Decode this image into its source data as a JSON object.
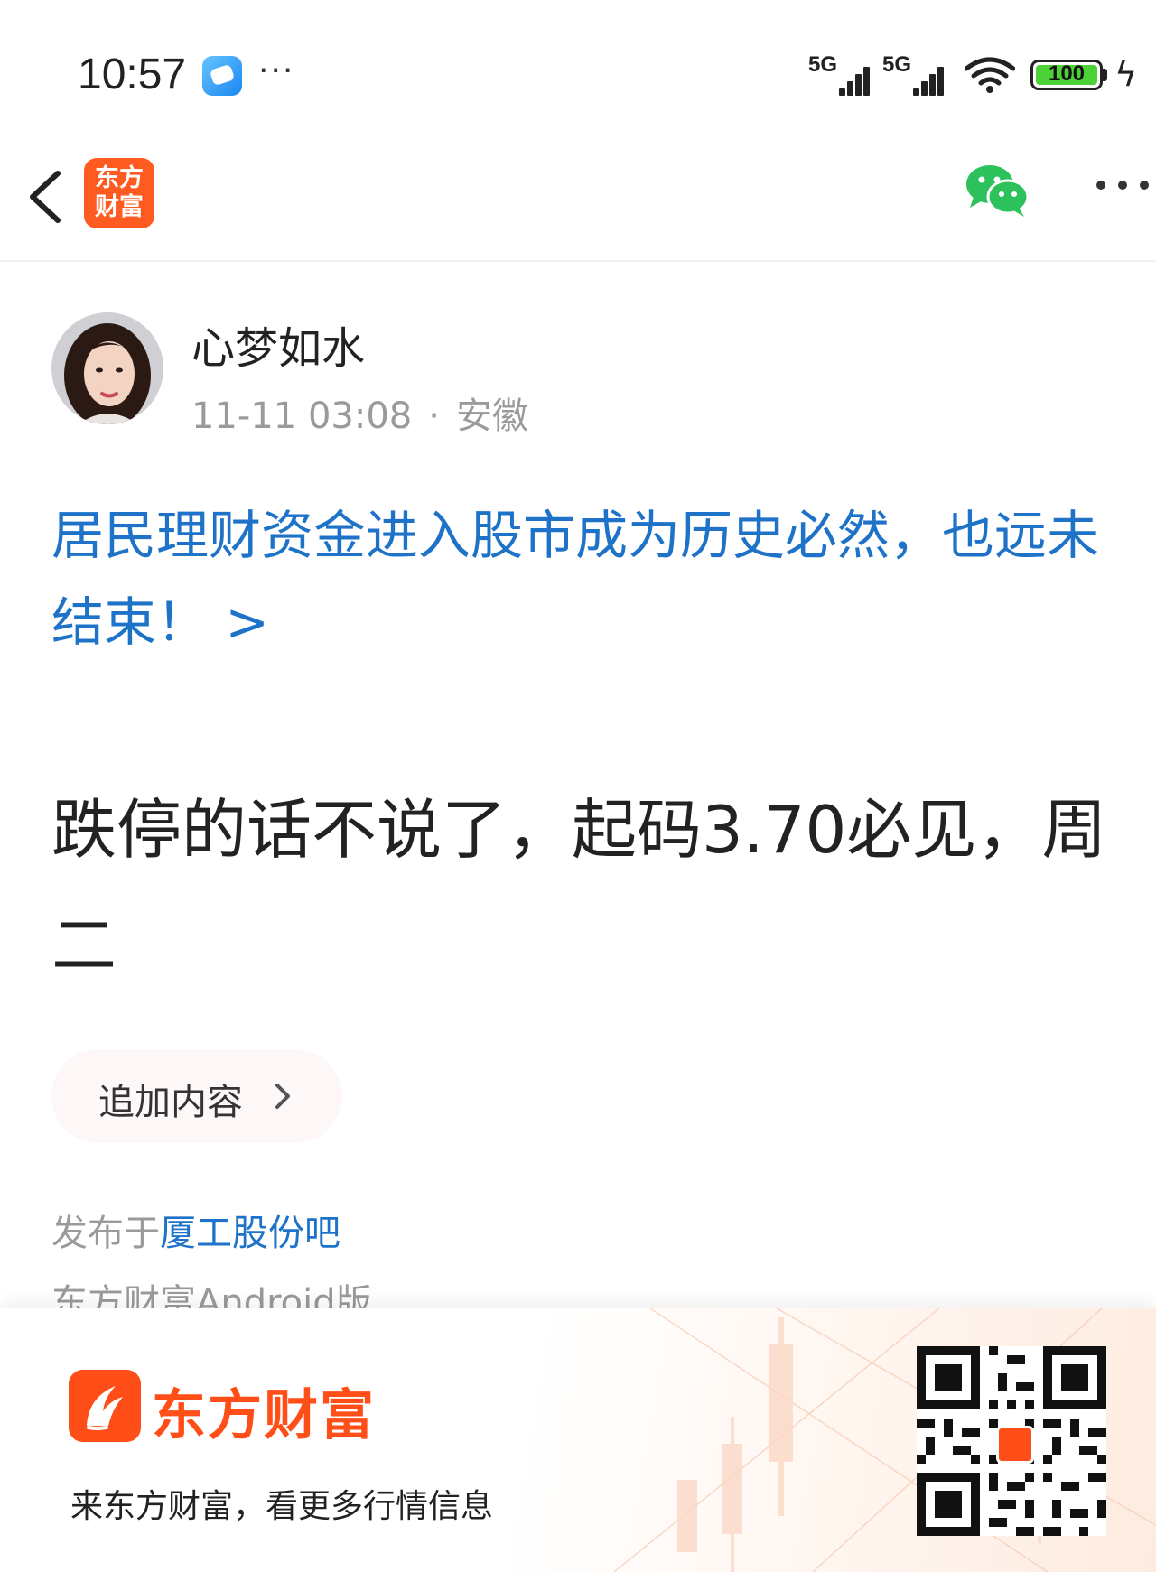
{
  "status_bar": {
    "time": "10:57",
    "more": "···",
    "signal1_label": "5G",
    "signal2_label": "5G",
    "battery_level": "100",
    "charging_icon": "bolt-icon"
  },
  "nav": {
    "logo_line1": "东方",
    "logo_line2": "财富",
    "accent_color": "#ff5a1f"
  },
  "author": {
    "name": "心梦如水",
    "time": "11-11 03:08",
    "separator": "·",
    "location": "安徽"
  },
  "topic": {
    "text": "居民理财资金进入股市成为历史必然，也远未结束！ >",
    "color": "#1e73c8"
  },
  "post": {
    "body": "跌停的话不说了，起码3.70必见，周二"
  },
  "append": {
    "label": "追加内容"
  },
  "footer": {
    "published_prefix": "发布于",
    "bar_name": "厦工股份吧",
    "client": "东方财富Android版"
  },
  "promo": {
    "brand": "东方财富",
    "tagline": "来东方财富，看更多行情信息",
    "brand_color": "#ff4e17"
  }
}
